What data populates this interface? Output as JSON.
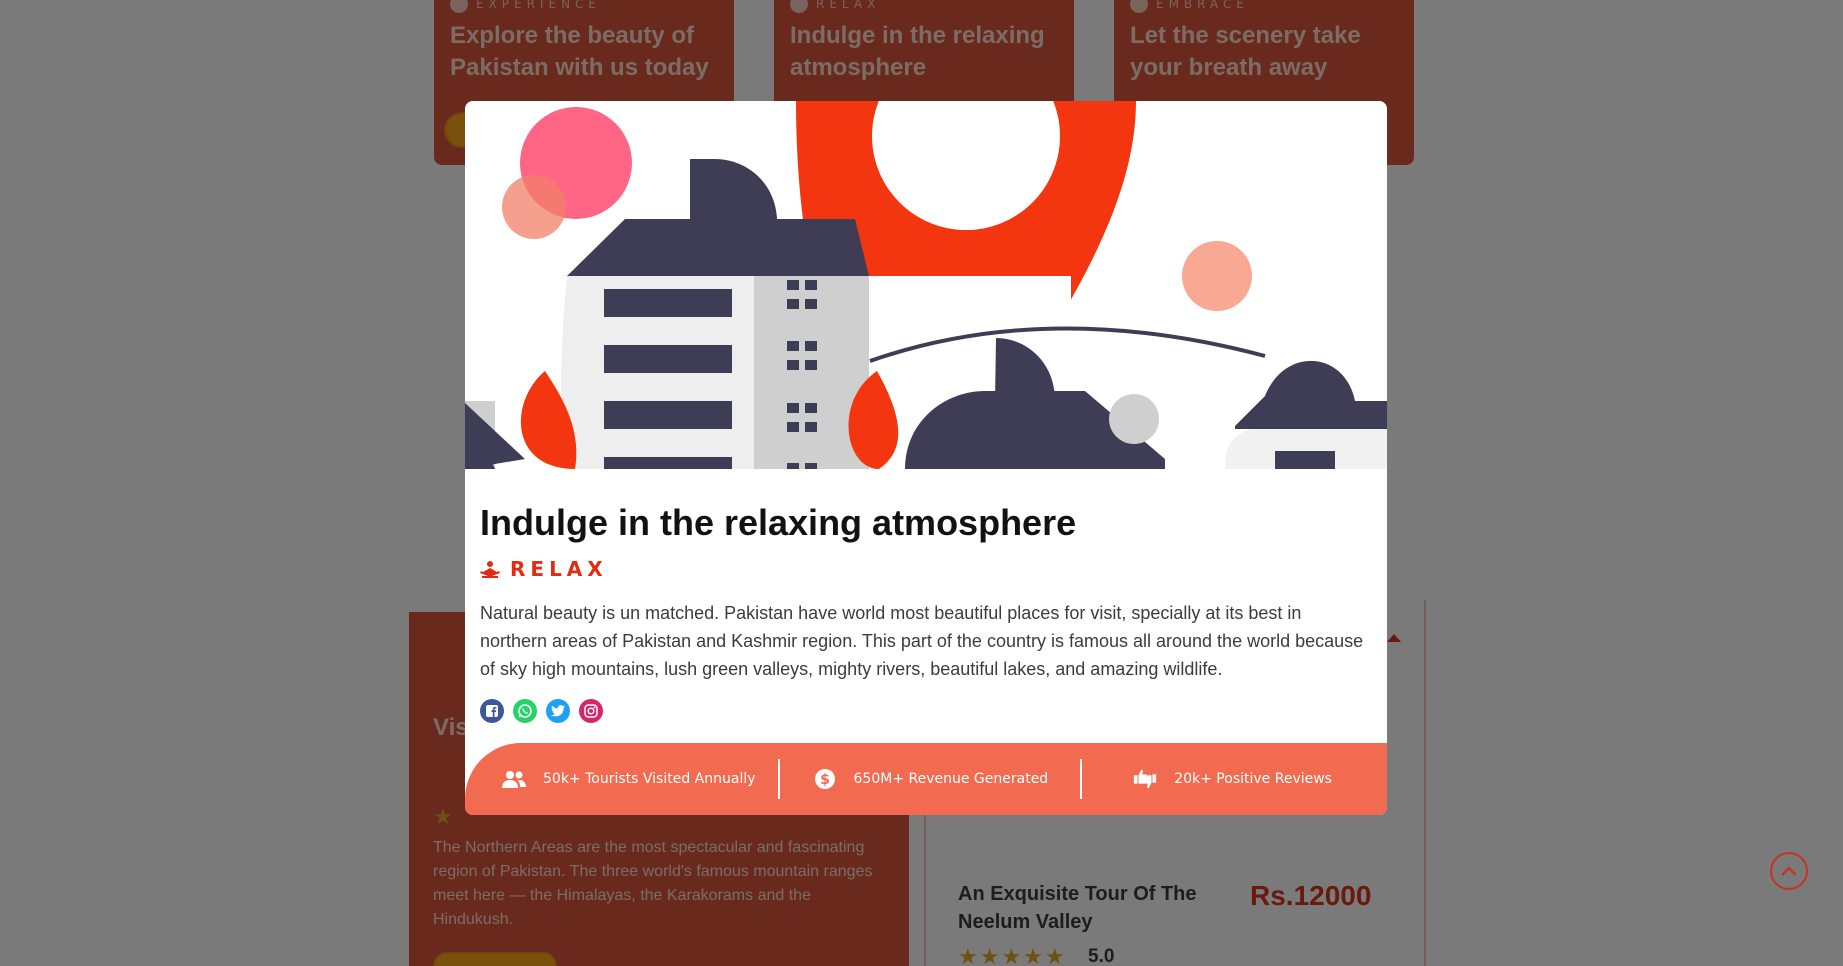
{
  "background": {
    "experience_cards": [
      {
        "tag": "EXPERIENCE",
        "title": "Explore the beauty of Pakistan with us today"
      },
      {
        "tag": "RELAX",
        "title": "Indulge in the relaxing atmosphere"
      },
      {
        "tag": "EMBRACE",
        "title": "Let the scenery take your breath away"
      }
    ],
    "north_card": {
      "title_fragment": "Vis No",
      "description": "The Northern Areas are the most spectacular and fascinating region of Pakistan. The three world's famous mountain ranges meet here — the Himalayas, the Karakorams and the Hindukush."
    },
    "tour_card": {
      "title": "An Exquisite Tour Of The Neelum Valley",
      "price": "Rs.12000",
      "rating": "5.0",
      "stars": "★★★★★"
    }
  },
  "modal": {
    "title": "Indulge in the relaxing atmosphere",
    "tag": "RELAX",
    "description": "Natural beauty is un matched. Pakistan have world most beautiful places for visit, specially at its best in northern areas of Pakistan and Kashmir region. This part of the country is famous all around the world because of sky high mountains, lush green valleys, mighty rivers, beautiful lakes, and amazing wildlife.",
    "socials": [
      "facebook-icon",
      "whatsapp-icon",
      "twitter-icon",
      "instagram-icon"
    ],
    "stats": [
      {
        "icon": "users-icon",
        "label": "50k+ Tourists Visited Annually"
      },
      {
        "icon": "dollar-icon",
        "label": "650M+ Revenue Generated"
      },
      {
        "icon": "thumbs-icon",
        "label": "20k+ Positive Reviews"
      }
    ]
  },
  "colors": {
    "accent": "#f26b50",
    "tag_red": "#e62a12",
    "card_orange": "#d2543a"
  }
}
